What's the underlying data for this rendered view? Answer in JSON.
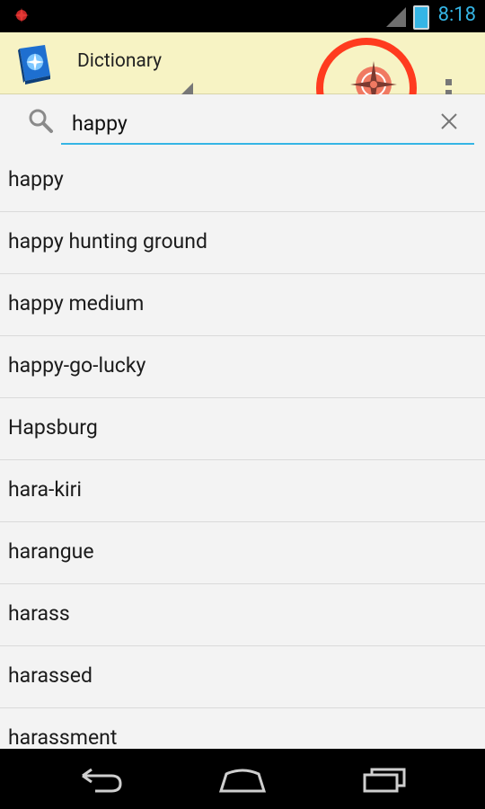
{
  "status_bar": {
    "time": "8:18"
  },
  "action_bar": {
    "title": "Dictionary"
  },
  "search": {
    "query": "happy",
    "placeholder": ""
  },
  "results": [
    "happy",
    "happy hunting ground",
    "happy medium",
    "happy-go-lucky",
    "Hapsburg",
    "hara-kiri",
    "harangue",
    "harass",
    "harassed",
    "harassment"
  ],
  "colors": {
    "accent": "#35b5e5",
    "action_bar_bg": "#f7f3c4",
    "highlight_ring": "#ff3b1f"
  },
  "icons": {
    "notification": "compass-icon",
    "app": "book-icon",
    "action": "compass-icon",
    "overflow": "overflow-menu-icon",
    "search": "search-icon",
    "clear": "close-icon",
    "nav": [
      "back-icon",
      "home-icon",
      "recents-icon"
    ]
  }
}
